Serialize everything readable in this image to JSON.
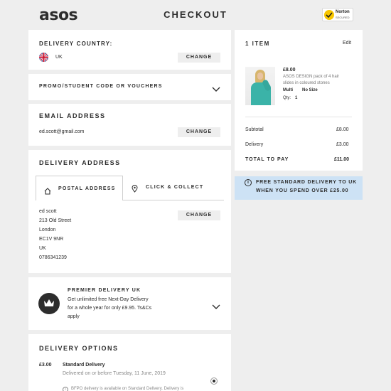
{
  "header": {
    "logo": "asos",
    "title": "CHECKOUT",
    "badge": {
      "name": "Norton",
      "sub": "SECURED"
    }
  },
  "delivery_country": {
    "title": "DELIVERY COUNTRY:",
    "country": "UK",
    "change_label": "CHANGE"
  },
  "promo": {
    "title": "PROMO/STUDENT CODE OR VOUCHERS"
  },
  "email": {
    "title": "EMAIL ADDRESS",
    "value": "ed.scott@gmail.com",
    "change_label": "CHANGE"
  },
  "delivery_address": {
    "title": "DELIVERY ADDRESS",
    "tabs": [
      {
        "label": "POSTAL ADDRESS",
        "selected": true
      },
      {
        "label": "CLICK & COLLECT",
        "selected": false
      }
    ],
    "address_lines": [
      "ed scott",
      "213 Old Street",
      "London",
      "EC1V 9NR",
      "UK",
      "0786341239"
    ],
    "change_label": "CHANGE"
  },
  "premier": {
    "title": "PREMIER DELIVERY UK",
    "lines": [
      "Get unlimited free Next-Day Delivery",
      "for a whole year for only £9.95. Ts&Cs",
      "apply"
    ]
  },
  "delivery_options": {
    "title": "DELIVERY OPTIONS",
    "price": "£3.00",
    "name": "Standard Delivery",
    "eta": "Delivered on or before Tuesday, 11 June, 2019",
    "note": "BFPO delivery is available on Standard Delivery. Delivery is"
  },
  "bag": {
    "title": "1 ITEM",
    "edit_label": "Edit",
    "item": {
      "price": "£8.00",
      "desc_lines": [
        "ASOS DESIGN pack of 4 hair",
        "slides in coloured stones"
      ],
      "colour": "Multi",
      "size": "No Size",
      "qty_label": "Qty:",
      "qty": "1"
    },
    "subtotal_label": "Subtotal",
    "subtotal": "£8.00",
    "delivery_label": "Delivery",
    "delivery": "£3.00",
    "total_label": "TOTAL TO PAY",
    "total": "£11.00"
  },
  "banner": {
    "lines": [
      "FREE STANDARD DELIVERY TO UK",
      "WHEN YOU SPEND OVER £25.00"
    ]
  },
  "colors": {
    "page_bg": "#eeeeee",
    "panel_bg": "#ffffff",
    "text": "#2d2d2d",
    "banner_bg": "#cde2f5",
    "norton_yellow": "#f7c600"
  }
}
